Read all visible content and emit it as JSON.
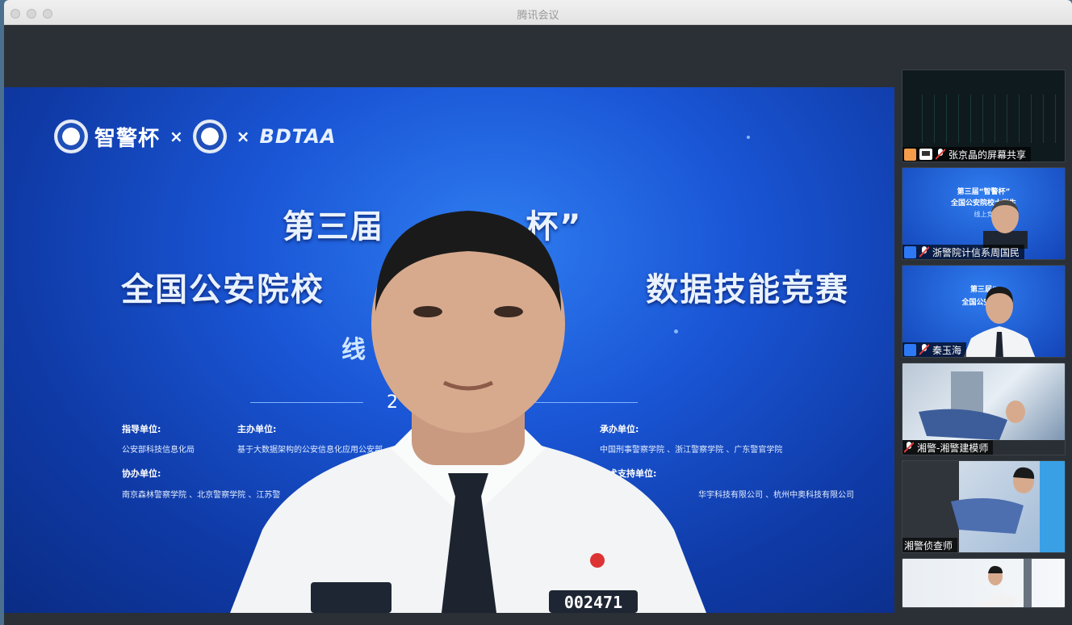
{
  "window": {
    "title": "腾讯会议"
  },
  "slide": {
    "logo_text": "智警杯",
    "logo_sep": "×",
    "logo_brand": "BDTAA",
    "headline1": "第三届           杯”",
    "headline2": "全国公安院校                         数据技能竞赛",
    "headline3": "线",
    "year_fragment": "2",
    "guide_label": "指导单位:",
    "guide_text": "公安部科技信息化局",
    "host_label": "主办单位:",
    "host_text": "基于大数据架构的公安信息化应用公安部",
    "organizer_label": "承办单位:",
    "organizer_text": "中国刑事警察学院 、浙江警察学院 、广东警官学院",
    "co_label": "协办单位:",
    "co_text": "南京森林警察学院 、北京警察学院 、江苏警",
    "tech_label": "技术支持单位:",
    "tech_text": "华宇科技有限公司 、杭州中奥科技有限公司",
    "badge_number": "002471"
  },
  "participants": [
    {
      "label": "张京晶的屏幕共享",
      "type": "screen-share"
    },
    {
      "label": "浙警院计信系周国民",
      "type": "camera",
      "mini_line1": "第三届“智警杯”",
      "mini_line2": "全国公安院校大学生",
      "mini_line3": "技能竞赛",
      "mini_line4": "线上竞"
    },
    {
      "label": "秦玉海",
      "type": "camera",
      "mini_line1": "第三届“",
      "mini_line2": "全国公安院校",
      "mini_line3": "据技能竞赛"
    },
    {
      "label": "湘警-湘警建模师",
      "type": "camera"
    },
    {
      "label": "湘警侦查师",
      "type": "camera"
    },
    {
      "label": "",
      "type": "camera"
    }
  ],
  "colors": {
    "slide_blue": "#1a56d6",
    "mic_red": "#e23b3b"
  }
}
